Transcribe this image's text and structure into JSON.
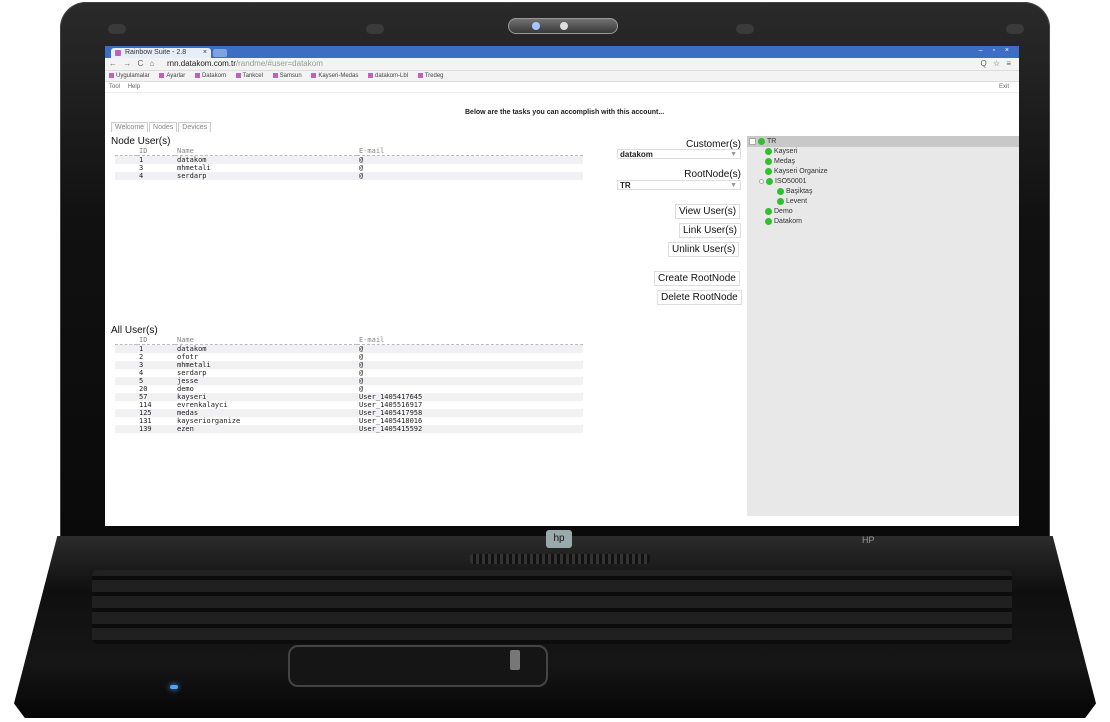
{
  "browser": {
    "tab_title": "Rainbow Suite - 2.8",
    "tab_close": "×",
    "url_host": "rnn.datakom.com.tr",
    "url_path": "/randme/#user=datakom",
    "nav_glyphs": "← → C ⌂",
    "right_glyphs": "Q ☆ ≡",
    "window_controls": "– ▫ ×",
    "bookmarks": [
      "Uygulamalar",
      "Ayarlar",
      "Datakom",
      "Tankcel",
      "Samsun",
      "Kayseri-Medas",
      "datakom-Lbl",
      "Tredeg"
    ]
  },
  "menu": {
    "items": [
      "Tool",
      "Help"
    ],
    "exit": "Exit"
  },
  "notice": "Below are the tasks you can accomplish with this account...",
  "tabs": [
    "Welcome",
    "Nodes",
    "Devices"
  ],
  "node_users": {
    "title": "Node User(s)",
    "columns": [
      "ID",
      "Name",
      "E-mail"
    ],
    "rows": [
      [
        "1",
        "datakom",
        "@"
      ],
      [
        "3",
        "mhmetali",
        "@"
      ],
      [
        "4",
        "serdarp",
        "@"
      ]
    ]
  },
  "all_users": {
    "title": "All User(s)",
    "columns": [
      "ID",
      "Name",
      "E-mail"
    ],
    "rows": [
      [
        "1",
        "datakom",
        "@"
      ],
      [
        "2",
        "ofotr",
        "@"
      ],
      [
        "3",
        "mhmetali",
        "@"
      ],
      [
        "4",
        "serdarp",
        "@"
      ],
      [
        "5",
        "jesse",
        "@"
      ],
      [
        "20",
        "demo",
        "@"
      ],
      [
        "57",
        "kayseri",
        "User_1405417645"
      ],
      [
        "114",
        "evrenkalayci",
        "User_1405516917"
      ],
      [
        "125",
        "medas",
        "User_1405417958"
      ],
      [
        "131",
        "kayseriorganize",
        "User_1405418016"
      ],
      [
        "139",
        "ezen",
        "User_1405415592"
      ]
    ]
  },
  "controls": {
    "customer_label": "Customer(s)",
    "customer_value": "datakom",
    "rootnode_label": "RootNode(s)",
    "rootnode_value": "TR",
    "view_users": "View User(s)",
    "link_users": "Link User(s)",
    "unlink_users": "Unlink User(s)",
    "create_rootnode": "Create RootNode",
    "delete_rootnode": "Delete RootNode",
    "dropdown_arrow": "▼"
  },
  "tree": {
    "root": "TR",
    "children": [
      "Kayseri",
      "Medaş",
      "Kayseri Organize",
      "ISO50001",
      "Demo",
      "Datakom"
    ],
    "iso_children": [
      "Başiktaş",
      "Levent"
    ]
  },
  "device": {
    "logo": "hp",
    "brand": "HP"
  }
}
